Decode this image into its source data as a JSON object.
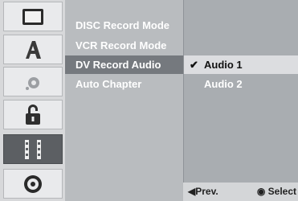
{
  "sidebar": {
    "icons": [
      {
        "name": "tv-screen-icon"
      },
      {
        "name": "language-a-icon"
      },
      {
        "name": "audio-icon"
      },
      {
        "name": "lock-icon"
      },
      {
        "name": "recording-film-icon",
        "selected": true
      },
      {
        "name": "disc-icon"
      }
    ]
  },
  "menu": {
    "items": [
      {
        "label": "DISC Record Mode"
      },
      {
        "label": "VCR Record Mode"
      },
      {
        "label": "DV Record Audio",
        "selected": true
      },
      {
        "label": "Auto Chapter"
      }
    ]
  },
  "options": {
    "items": [
      {
        "label": "Audio 1",
        "checked": true,
        "check_mark": "✔"
      },
      {
        "label": "Audio 2",
        "checked": false,
        "check_mark": ""
      }
    ]
  },
  "footer": {
    "prev_arrow": "◀",
    "prev_label": "Prev.",
    "select_glyph": "◉",
    "select_label": "Select"
  },
  "colors": {
    "menu_highlight": "#75797e",
    "option_highlight": "#dcdde0",
    "selected_icon_bg": "#5c5f63"
  }
}
